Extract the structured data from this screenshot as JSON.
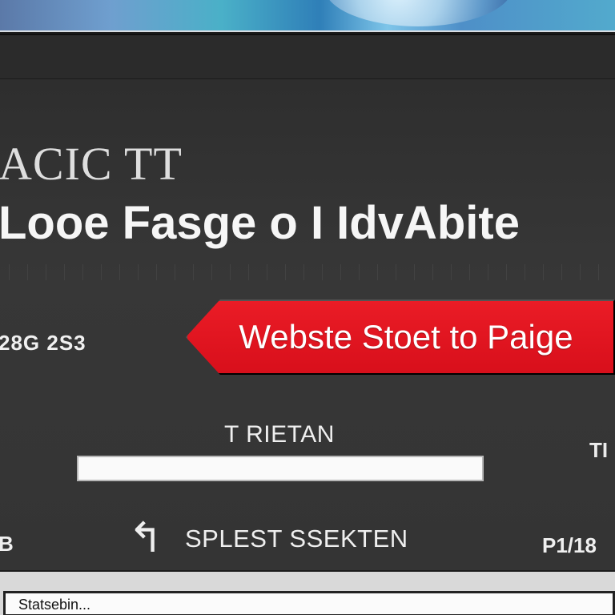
{
  "top": {
    "strip_color": "#6f9fcf"
  },
  "brand": {
    "text": "ACIC TT"
  },
  "headline": {
    "text": "Looe Fasge o I IdvAbite"
  },
  "stats": {
    "left_value": "28G 2S3"
  },
  "cta": {
    "label": "Webste Stoet to Paige",
    "color": "#e31a23"
  },
  "form": {
    "label": "T RIETAN",
    "input_value": "",
    "input_placeholder": ""
  },
  "side": {
    "marker": "TI"
  },
  "footer": {
    "left_number": "B",
    "label": "SPLEST SSEKTEN",
    "pager": "P1/18"
  },
  "status": {
    "text": "Statsebin..."
  }
}
